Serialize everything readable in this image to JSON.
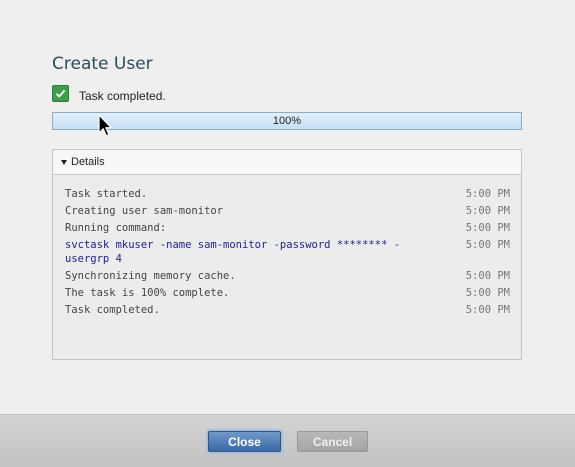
{
  "dialog": {
    "title": "Create User",
    "status_text": "Task completed.",
    "progress": {
      "percent": 100,
      "label": "100%"
    },
    "details_label": "Details",
    "log": [
      {
        "message": "Task started.",
        "time": "5:00 PM",
        "kind": "info"
      },
      {
        "message": "Creating user sam-monitor",
        "time": "5:00 PM",
        "kind": "info"
      },
      {
        "message": "Running command:",
        "time": "5:00 PM",
        "kind": "info"
      },
      {
        "message": "svctask mkuser -name sam-monitor -password ******** -usergrp 4",
        "time": "5:00 PM",
        "kind": "command"
      },
      {
        "message": "Synchronizing memory cache.",
        "time": "5:00 PM",
        "kind": "info"
      },
      {
        "message": "The task is 100% complete.",
        "time": "5:00 PM",
        "kind": "info"
      },
      {
        "message": "Task completed.",
        "time": "5:00 PM",
        "kind": "info"
      }
    ]
  },
  "buttons": {
    "close": "Close",
    "cancel": "Cancel"
  },
  "colors": {
    "title": "#2d4c5a",
    "check": "#3f9e4a",
    "command_text": "#20209a",
    "close_button": "#3a69a5"
  },
  "icons": {
    "status": "checkmark-icon",
    "details_toggle": "triangle-down-icon",
    "pointer": "mouse-pointer-icon"
  }
}
